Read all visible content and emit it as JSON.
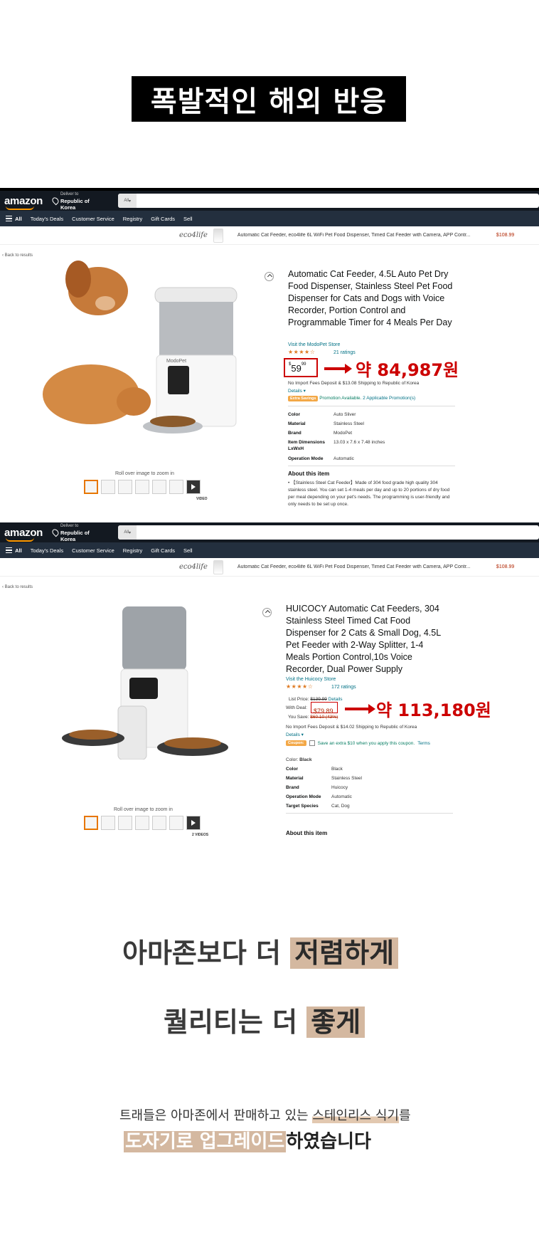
{
  "headline": "폭발적인 해외 반응",
  "amazon": {
    "logo": "amazon",
    "deliver_to": "Deliver to",
    "deliver_location": "Republic of Korea",
    "search_category": "All",
    "nav": [
      "All",
      "Today's Deals",
      "Customer Service",
      "Registry",
      "Gift Cards",
      "Sell"
    ],
    "ad_brand": "eco4life",
    "ad_text": "Automatic Cat Feeder, eco4life 6L WiFi Pet Food Dispenser, Timed Cat Feeder with Camera, APP Contr...",
    "ad_price": "$108.99",
    "back_to_results": "‹ Back to results",
    "rollover_text": "Roll over image to zoom in"
  },
  "product1": {
    "title": "Automatic Cat Feeder, 4.5L Auto Pet Dry Food Dispenser, Stainless Steel Pet Food Dispenser for Cats and Dogs with Voice Recorder, Portion Control and Programmable Timer for 4 Meals Per Day",
    "store": "Visit the ModoPet Store",
    "stars": "★★★★☆",
    "ratings": "21 ratings",
    "price_whole": "59",
    "price_fraction": "99",
    "price_currency": "$",
    "krw": "약 84,987원",
    "shipping": "No Import Fees Deposit & $13.08 Shipping to Republic of Korea",
    "details": "Details",
    "extra_savings": "Extra Savings",
    "promo_available": "Promotion Available.",
    "promo_link": "2 Applicable Promotion(s)",
    "specs": [
      {
        "k": "Color",
        "v": "Auto Sliver"
      },
      {
        "k": "Material",
        "v": "Stainless Steel"
      },
      {
        "k": "Brand",
        "v": "ModoPet"
      },
      {
        "k": "Item Dimensions LxWxH",
        "v": "13.03 x 7.6 x 7.48 inches"
      },
      {
        "k": "Operation Mode",
        "v": "Automatic"
      }
    ],
    "about_title": "About this item",
    "about_text": "【Stainless Steel Cat Feeder】Made of 304 food grade high quality 304 stainless steel. You can set 1-4 meals per day and up to 20 portions of dry food per meal depending on your pet's needs. The programming is user-friendly and only needs to be set up once.",
    "video_label": "VIDEO",
    "brand_mark": "ModoPet"
  },
  "product2": {
    "title": "HUICOCY Automatic Cat Feeders, 304 Stainless Steel Timed Cat Food Dispenser for 2 Cats & Small Dog, 4.5L Pet Feeder with 2-Way Splitter, 1-4 Meals Portion Control,10s Voice Recorder, Dual Power Supply",
    "store": "Visit the Huicocy Store",
    "stars": "★★★★☆",
    "ratings": "172 ratings",
    "list_price_label": "List Price:",
    "list_price": "$139.99",
    "list_details": "Details",
    "deal_label": "With Deal:",
    "deal_price": "$79.89",
    "save_label": "You Save:",
    "save_value": "$60.10 (43%)",
    "krw": "약 113,180원",
    "shipping": "No Import Fees Deposit & $14.02 Shipping to Republic of Korea",
    "details": "Details",
    "coupon_badge": "Coupon:",
    "coupon_text": "Save an extra $10 when you apply this coupon.",
    "coupon_terms": "Terms",
    "color_label": "Color:",
    "color_value": "Black",
    "specs": [
      {
        "k": "Color",
        "v": "Black"
      },
      {
        "k": "Material",
        "v": "Stainless Steel"
      },
      {
        "k": "Brand",
        "v": "Huicocy"
      },
      {
        "k": "Operation Mode",
        "v": "Automatic"
      },
      {
        "k": "Target Species",
        "v": "Cat, Dog"
      }
    ],
    "about_title": "About this item",
    "video_label": "2 VIDEOS"
  },
  "copy": {
    "line1_a": "아마존보다 더",
    "line1_b": "저렴하게",
    "line2_a": "퀄리티는 더",
    "line2_b": "좋게",
    "foot1_a": "트래들은 아마존에서 판매하고 있는 ",
    "foot1_b": "스테인리스 식기",
    "foot1_c": "를",
    "foot2_a": "도자기로 업그레이드",
    "foot2_b": "하였습니다"
  },
  "colors": {
    "amazon_nav": "#131921",
    "amazon_subnav": "#232f3e",
    "annotation_red": "#cc0000",
    "highlight": "#d4b8a0"
  }
}
